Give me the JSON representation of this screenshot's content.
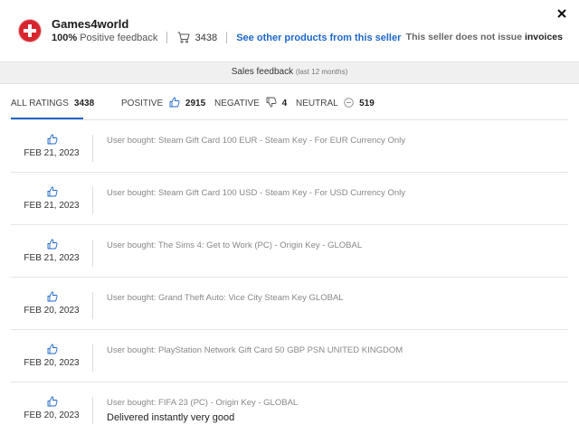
{
  "seller": {
    "name": "Games4world",
    "positive_pct": "100%",
    "positive_label": "Positive feedback",
    "sales_count": "3438",
    "see_products_link": "See other products from this seller",
    "invoice_note_prefix": "This seller does not issue",
    "invoice_note_bold": "invoices"
  },
  "feedback_bar": {
    "title": "Sales feedback",
    "subtitle": "(last 12 months)"
  },
  "tabs": [
    {
      "label": "ALL RATINGS",
      "count": "3438"
    },
    {
      "label": "POSITIVE",
      "count": "2915"
    },
    {
      "label": "NEGATIVE",
      "count": "4"
    },
    {
      "label": "NEUTRAL",
      "count": "519"
    }
  ],
  "reviews": [
    {
      "date": "FEB 21, 2023",
      "bought": "User bought: Steam Gift Card 100 EUR - Steam Key - For EUR Currency Only",
      "comment": ""
    },
    {
      "date": "FEB 21, 2023",
      "bought": "User bought: Steam Gift Card 100 USD - Steam Key - For USD Currency Only",
      "comment": ""
    },
    {
      "date": "FEB 21, 2023",
      "bought": "User bought: The Sims 4: Get to Work (PC) - Origin Key - GLOBAL",
      "comment": ""
    },
    {
      "date": "FEB 20, 2023",
      "bought": "User bought: Grand Theft Auto: Vice City Steam Key GLOBAL",
      "comment": ""
    },
    {
      "date": "FEB 20, 2023",
      "bought": "User bought: PlayStation Network Gift Card 50 GBP PSN UNITED KINGDOM",
      "comment": ""
    },
    {
      "date": "FEB 20, 2023",
      "bought": "User bought: FIFA 23 (PC) - Origin Key - GLOBAL",
      "comment": "Delivered instantly very good"
    }
  ],
  "colors": {
    "accent": "#1f67c9",
    "logo_red": "#d8262e"
  }
}
